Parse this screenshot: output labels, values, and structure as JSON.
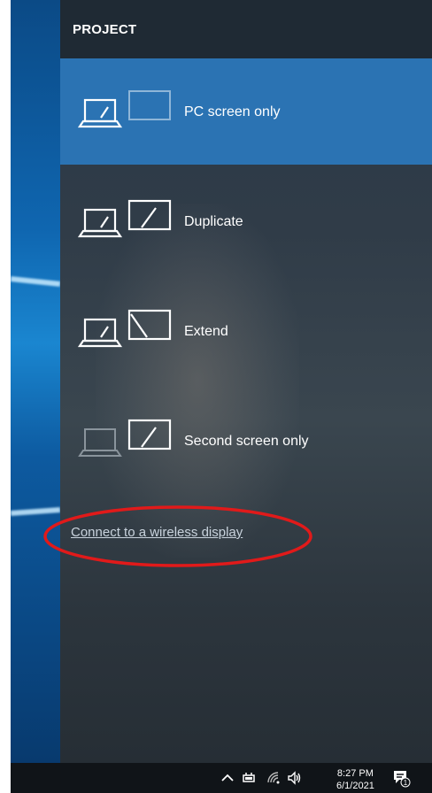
{
  "panel": {
    "title": "PROJECT",
    "options": [
      {
        "label": "PC screen only",
        "icon": "pc-screen-only-icon",
        "selected": true
      },
      {
        "label": "Duplicate",
        "icon": "duplicate-icon",
        "selected": false
      },
      {
        "label": "Extend",
        "icon": "extend-icon",
        "selected": false
      },
      {
        "label": "Second screen only",
        "icon": "second-screen-only-icon",
        "selected": false
      }
    ],
    "wireless_link": "Connect to a wireless display"
  },
  "taskbar": {
    "time": "8:27 PM",
    "date": "6/1/2021",
    "notification_count": "1"
  },
  "colors": {
    "selected": "#2b73b3",
    "annotation": "#e11a1a"
  }
}
